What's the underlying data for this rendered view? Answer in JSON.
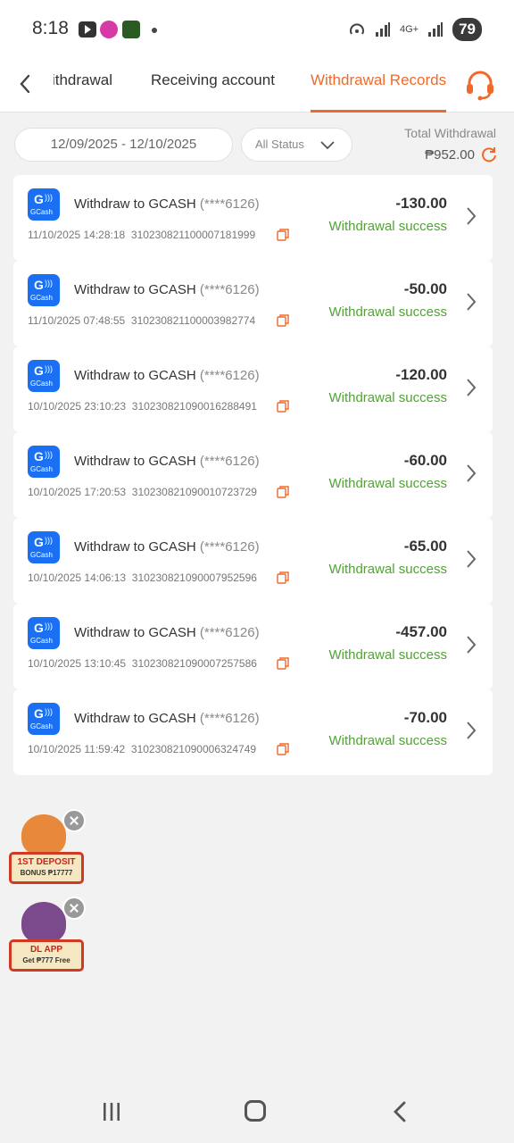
{
  "status_bar": {
    "time": "8:18",
    "network": "4G+",
    "battery": "79"
  },
  "header": {
    "tabs": [
      {
        "label": "Withdrawal"
      },
      {
        "label": "Receiving account"
      },
      {
        "label": "Withdrawal Records"
      }
    ],
    "active_tab": 2,
    "accent_color": "#ef6a2a"
  },
  "filters": {
    "date_range": "12/09/2025 - 12/10/2025",
    "status": "All Status"
  },
  "summary": {
    "total_label": "Total Withdrawal",
    "total_amount": "₱952.00"
  },
  "records": [
    {
      "title": "Withdraw to GCASH",
      "account": "(****6126)",
      "datetime": "11/10/2025 14:28:18",
      "ref": "310230821100007181999",
      "amount": "-130.00",
      "status": "Withdrawal success"
    },
    {
      "title": "Withdraw to GCASH",
      "account": "(****6126)",
      "datetime": "11/10/2025 07:48:55",
      "ref": "310230821100003982774",
      "amount": "-50.00",
      "status": "Withdrawal success"
    },
    {
      "title": "Withdraw to GCASH",
      "account": "(****6126)",
      "datetime": "10/10/2025 23:10:23",
      "ref": "310230821090016288491",
      "amount": "-120.00",
      "status": "Withdrawal success"
    },
    {
      "title": "Withdraw to GCASH",
      "account": "(****6126)",
      "datetime": "10/10/2025 17:20:53",
      "ref": "310230821090010723729",
      "amount": "-60.00",
      "status": "Withdrawal success"
    },
    {
      "title": "Withdraw to GCASH",
      "account": "(****6126)",
      "datetime": "10/10/2025 14:06:13",
      "ref": "310230821090007952596",
      "amount": "-65.00",
      "status": "Withdrawal success"
    },
    {
      "title": "Withdraw to GCASH",
      "account": "(****6126)",
      "datetime": "10/10/2025 13:10:45",
      "ref": "310230821090007257586",
      "amount": "-457.00",
      "status": "Withdrawal success"
    },
    {
      "title": "Withdraw to GCASH",
      "account": "(****6126)",
      "datetime": "10/10/2025 11:59:42",
      "ref": "310230821090006324749",
      "amount": "-70.00",
      "status": "Withdrawal success"
    }
  ],
  "gcash_logo": {
    "text": "GCash",
    "letter": "G",
    "color": "#1a6ff2"
  },
  "success_color": "#4fa530",
  "promos": {
    "deposit": {
      "line1": "1ST DEPOSIT",
      "line2": "BONUS ₱17777"
    },
    "app": {
      "line1": "DL APP",
      "line2": "Get ₱777 Free"
    }
  }
}
